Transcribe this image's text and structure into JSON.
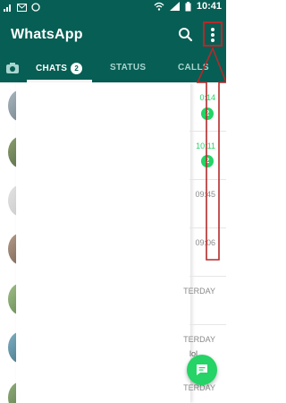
{
  "status_bar": {
    "time": "10:41"
  },
  "app": {
    "title": "WhatsApp"
  },
  "tabs": {
    "chats_label": "CHATS",
    "chats_badge": "2",
    "status_label": "STATUS",
    "calls_label": "CALLS"
  },
  "chats": [
    {
      "time": "0:14",
      "unread": "2"
    },
    {
      "time": "10:11",
      "unread": "2"
    },
    {
      "time": "09:45"
    },
    {
      "time": "09:06"
    },
    {
      "time": "TERDAY"
    },
    {
      "time": "TERDAY",
      "snippet": "lol"
    },
    {
      "time": "TERDAY"
    }
  ],
  "colors": {
    "primary": "#075e54",
    "accent": "#25d366",
    "annotation": "#b32a2a"
  },
  "icons": {
    "search": "search-icon",
    "menu": "more-vert-icon",
    "camera": "camera-icon",
    "fab": "chat-icon"
  }
}
